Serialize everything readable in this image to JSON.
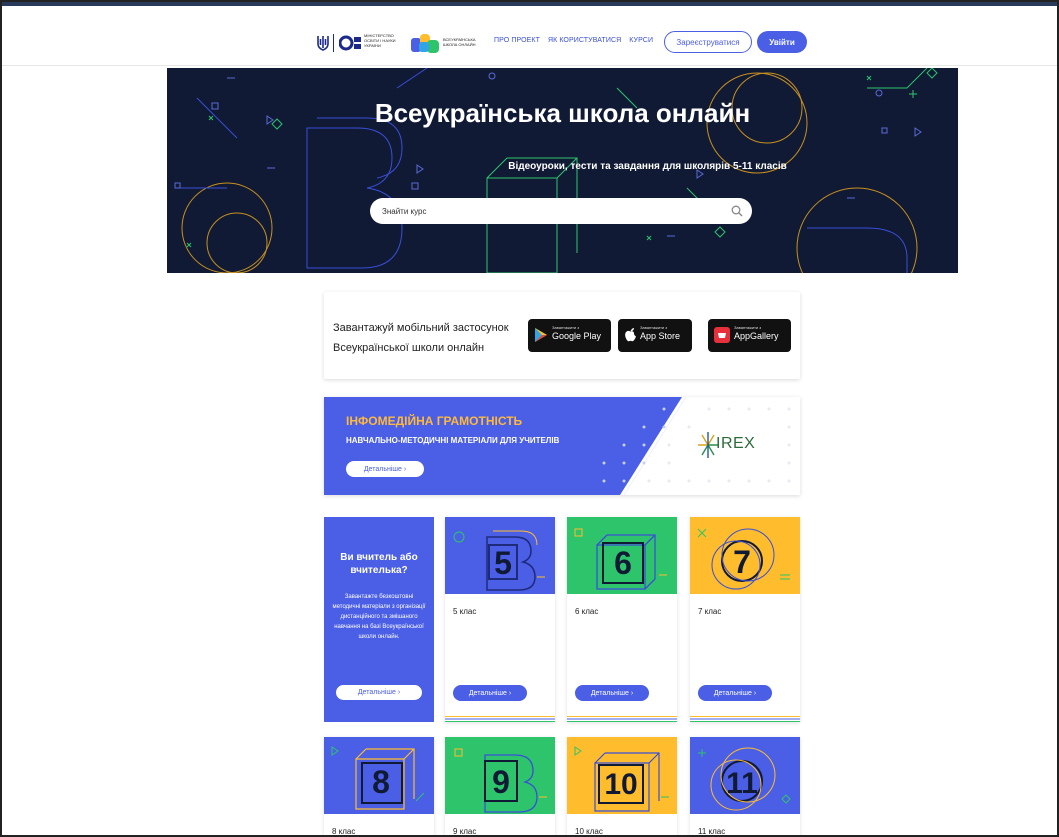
{
  "header": {
    "mon_logo_text": "МІНІСТЕРСТВО ОСВІТИ І НАУКИ УКРАЇНИ",
    "school_logo_text": "ВСЕУКРАЇНСЬКА ШКОЛА ОНЛАЙН",
    "nav": [
      "ПРО ПРОЕКТ",
      "ЯК КОРИСТУВАТИСЯ",
      "КУРСИ"
    ],
    "register_label": "Зареєструватися",
    "login_label": "Увійти"
  },
  "hero": {
    "title": "Всеукраїнська школа онлайн",
    "subtitle": "Відеоуроки, тести та завдання для школярів 5-11 класів",
    "search_placeholder": "Знайти курс"
  },
  "apps": {
    "text": "Завантажуй мобільний застосунок Всеукраїнської школи онлайн",
    "stores": [
      {
        "small": "Завантажити з",
        "big": "Google Play",
        "icon": "google-play-icon"
      },
      {
        "small": "Завантажити з",
        "big": "App Store",
        "icon": "apple-icon"
      },
      {
        "small": "Завантажити з",
        "big": "AppGallery",
        "icon": "huawei-icon"
      }
    ]
  },
  "banner": {
    "title": "ІНФОМЕДІЙНА ГРАМОТНІСТЬ",
    "subtitle": "НАВЧАЛЬНО-МЕТОДИЧНІ МАТЕРІАЛИ ДЛЯ УЧИТЕЛІВ",
    "button": "Детальніше  ›",
    "partner": "IREX"
  },
  "teacher": {
    "title": "Ви вчитель або вчителька?",
    "text": "Завантажте безкоштовні методичні матеріали з організації дистанційного та змішаного навчання на базі Всеукраїнської школи онлайн.",
    "button": "Детальніше  ›"
  },
  "grades": [
    {
      "number": "5",
      "label": "5 клас",
      "button": "Детальніше  ›",
      "color": "#4a5ee6"
    },
    {
      "number": "6",
      "label": "6 клас",
      "button": "Детальніше  ›",
      "color": "#2ec46b"
    },
    {
      "number": "7",
      "label": "7 клас",
      "button": "Детальніше  ›",
      "color": "#ffbd2e"
    },
    {
      "number": "8",
      "label": "8 клас",
      "color": "#4a5ee6"
    },
    {
      "number": "9",
      "label": "9 клас",
      "color": "#2ec46b"
    },
    {
      "number": "10",
      "label": "10 клас",
      "color": "#ffbd2e"
    },
    {
      "number": "11",
      "label": "11 клас",
      "color": "#4a5ee6"
    }
  ],
  "colors": {
    "accent": "#4a5ee6",
    "hero_bg": "#101a35",
    "banner_title": "#ffb93b"
  }
}
